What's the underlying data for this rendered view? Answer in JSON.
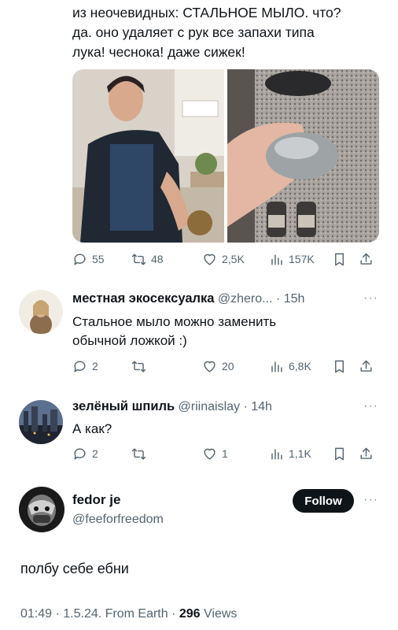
{
  "original_tweet": {
    "text_lines": [
      "из неочевидных: СТАЛЬНОЕ МЫЛО. что?",
      "да. оно удаляет с рук все запахи типа",
      "лука! чеснока! даже сижек!"
    ],
    "media": [
      {
        "icon": "photo-woman-kitchen"
      },
      {
        "icon": "photo-steel-soap"
      }
    ],
    "actions": {
      "replies": "55",
      "retweets": "48",
      "likes": "2,5K",
      "views": "157K"
    }
  },
  "replies": [
    {
      "name": "местная экосексуалка",
      "handle": "@zhero...",
      "time": "· 15h",
      "text_lines": [
        "Стальное мыло можно заменить",
        "обычной ложкой :)"
      ],
      "actions": {
        "replies": "2",
        "retweets": "",
        "likes": "20",
        "views": "6,8K"
      }
    },
    {
      "name": "зелёный шпиль",
      "handle": "@riinaislay",
      "time": "· 14h",
      "text_lines": [
        "А как?"
      ],
      "actions": {
        "replies": "2",
        "retweets": "",
        "likes": "1",
        "views": "1,1K"
      }
    }
  ],
  "focused_tweet": {
    "name": "fedor je",
    "handle": "@feeforfreedom",
    "follow_label": "Follow",
    "text": "полбу себе ебни",
    "time": "01:49 · 1.5.24. From Earth ·",
    "views_count": "296",
    "views_label": "Views"
  },
  "more_label": "···",
  "colors": {
    "text": "#0f1419",
    "secondary": "#536471",
    "follow_bg": "#0f1419"
  }
}
